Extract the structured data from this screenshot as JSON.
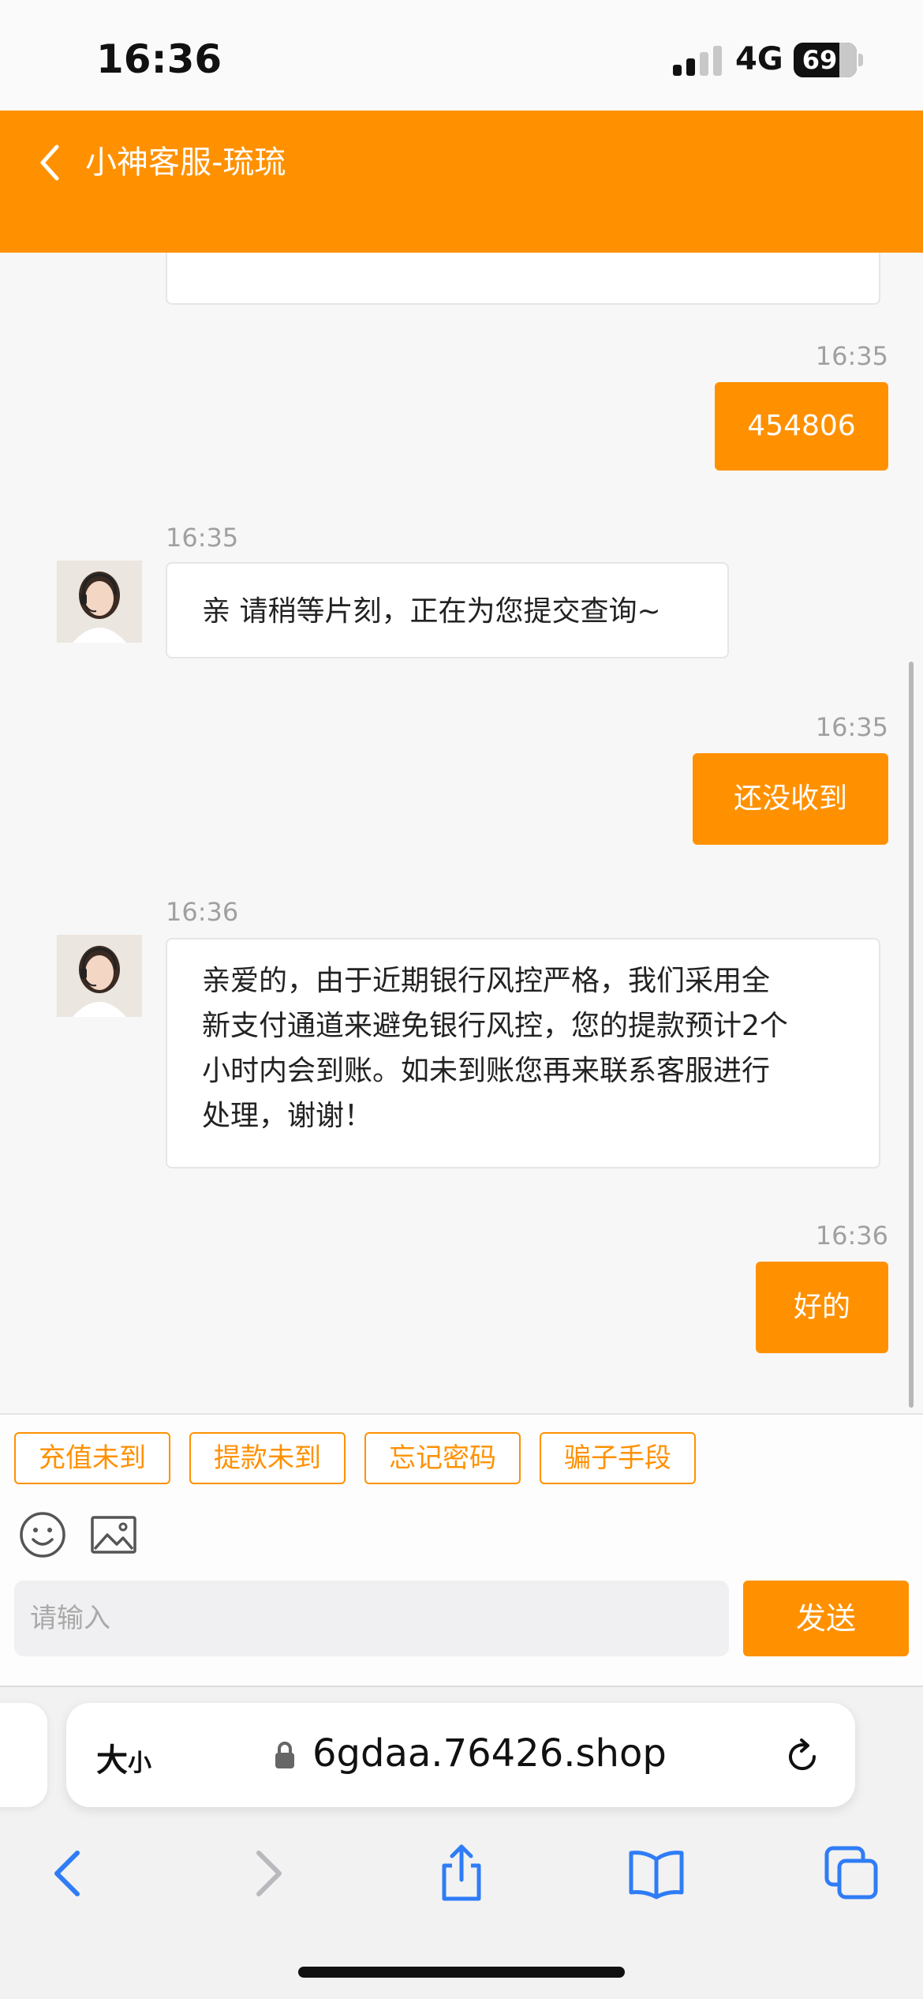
{
  "status_bar": {
    "time": "16:36",
    "network": "4G",
    "battery": "69"
  },
  "header": {
    "title": "小神客服-琉琉"
  },
  "messages": [
    {
      "side": "right",
      "time": "16:35",
      "text": "454806"
    },
    {
      "side": "left",
      "time": "16:35",
      "text": "亲 请稍等片刻，正在为您提交查询~"
    },
    {
      "side": "right",
      "time": "16:35",
      "text": "还没收到"
    },
    {
      "side": "left",
      "time": "16:36",
      "lines": [
        "亲爱的，由于近期银行风控严格，我们采用全",
        "新支付通道来避免银行风控，您的提款预计2个",
        "小时内会到账。如未到账您再来联系客服进行",
        "处理，谢谢！"
      ]
    },
    {
      "side": "right",
      "time": "16:36",
      "text": "好的"
    }
  ],
  "quick_replies": [
    "充值未到",
    "提款未到",
    "忘记密码",
    "骗子手段"
  ],
  "input": {
    "placeholder": "请输入",
    "send_label": "发送"
  },
  "browser": {
    "text_size_label_big": "大",
    "text_size_label_small": "小",
    "url": "6gdaa.76426.shop"
  },
  "colors": {
    "accent": "#ff9100",
    "icon_blue": "#2f7cf6"
  }
}
